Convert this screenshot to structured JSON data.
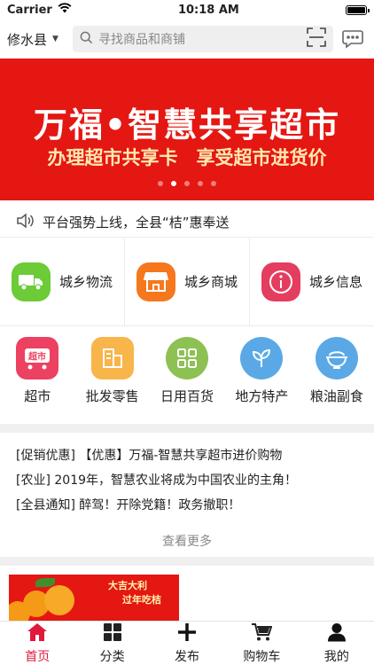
{
  "status": {
    "carrier": "Carrier",
    "time": "10:18 AM"
  },
  "header": {
    "location": "修水县",
    "search_placeholder": "寻找商品和商铺"
  },
  "banner": {
    "title": "万福•智慧共享超市",
    "subtitle": "办理超市共享卡　享受超市进货价",
    "slide_count": 5,
    "active_slide": 2
  },
  "notice": {
    "text": "平台强势上线，全县“桔”惠奉送"
  },
  "services": [
    {
      "label": "城乡物流",
      "icon": "truck-icon",
      "color": "#6ccb36"
    },
    {
      "label": "城乡商城",
      "icon": "store-icon",
      "color": "#f5781e"
    },
    {
      "label": "城乡信息",
      "icon": "info-icon",
      "color": "#e43d5f"
    }
  ],
  "categories": [
    {
      "label": "超市",
      "icon": "supermarket-icon",
      "color": "#ec4161",
      "badge": "超市"
    },
    {
      "label": "批发零售",
      "icon": "wholesale-icon",
      "color": "#f8b54a"
    },
    {
      "label": "日用百货",
      "icon": "grid-icon",
      "color": "#8dc153"
    },
    {
      "label": "地方特产",
      "icon": "leaf-icon",
      "color": "#5aa9e6"
    },
    {
      "label": "粮油副食",
      "icon": "bowl-icon",
      "color": "#5aa9e6"
    }
  ],
  "news": [
    "[促销优惠]  【优惠】万福-智慧共享超市进价购物",
    "[农业]  2019年，智慧农业将成为中国农业的主角！",
    "[全县通知]  醉驾！开除党籍！政务撤职！"
  ],
  "more_label": "查看更多",
  "promo": {
    "line1": "大吉大利",
    "line2": "过年吃桔"
  },
  "tabbar": [
    {
      "label": "首页",
      "icon": "home-icon",
      "active": true
    },
    {
      "label": "分类",
      "icon": "category-icon",
      "active": false
    },
    {
      "label": "发布",
      "icon": "plus-icon",
      "active": false
    },
    {
      "label": "购物车",
      "icon": "cart-icon",
      "active": false
    },
    {
      "label": "我的",
      "icon": "user-icon",
      "active": false
    }
  ],
  "colors": {
    "brand_red": "#e41712",
    "tab_active": "#e0193d"
  }
}
